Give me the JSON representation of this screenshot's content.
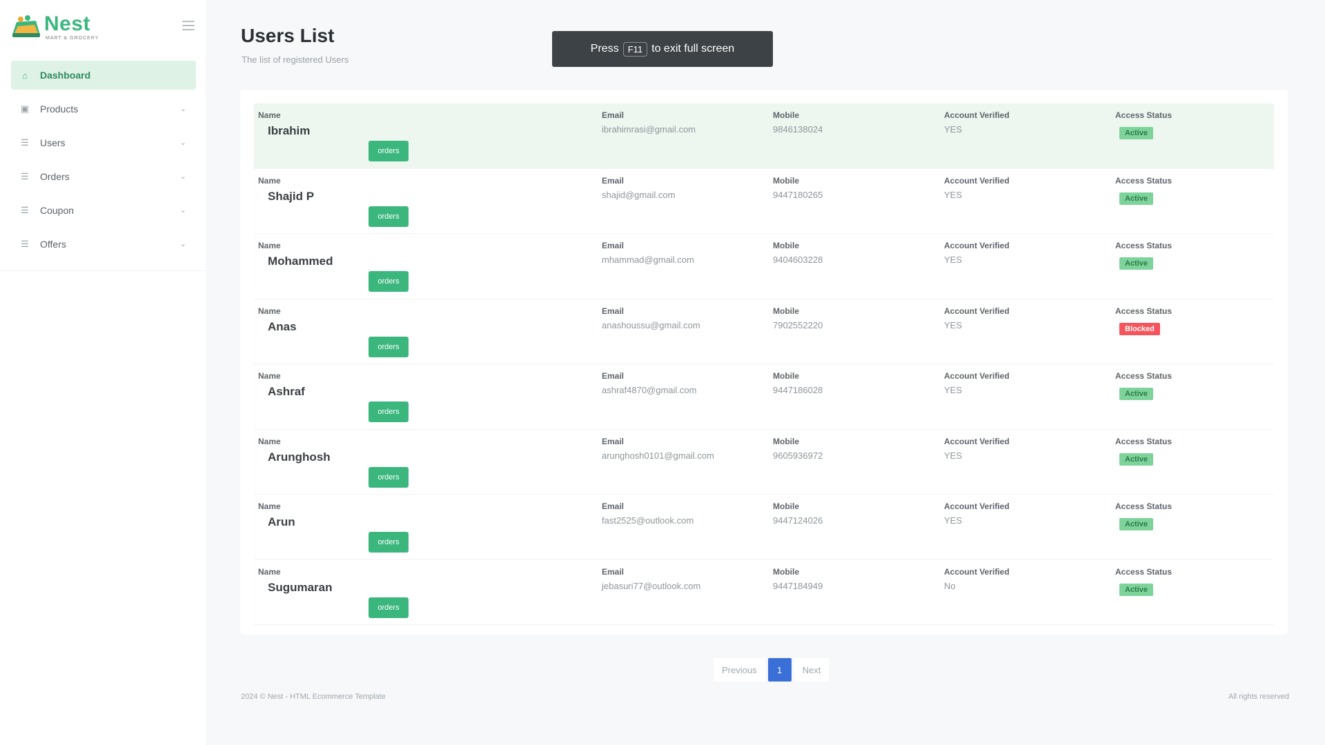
{
  "brand": {
    "name": "Nest",
    "tagline": "MART & GROCERY"
  },
  "sidebar": {
    "items": [
      {
        "label": "Dashboard",
        "icon": "home-icon",
        "active": true
      },
      {
        "label": "Products",
        "icon": "box-icon",
        "active": false
      },
      {
        "label": "Users",
        "icon": "users-icon",
        "active": false
      },
      {
        "label": "Orders",
        "icon": "cart-icon",
        "active": false
      },
      {
        "label": "Coupon",
        "icon": "ticket-icon",
        "active": false
      },
      {
        "label": "Offers",
        "icon": "tag-icon",
        "active": false
      }
    ]
  },
  "page": {
    "title": "Users List",
    "subtitle": "The list of registered Users"
  },
  "toast": {
    "prefix": "Press",
    "key": "F11",
    "suffix": "to exit full screen"
  },
  "table": {
    "labels": {
      "name": "Name",
      "email": "Email",
      "mobile": "Mobile",
      "verified": "Account Verified",
      "status": "Access Status"
    },
    "button_label": "orders",
    "rows": [
      {
        "name": "Ibrahim",
        "email": "ibrahimrasi@gmail.com",
        "mobile": "9846138024",
        "verified": "YES",
        "status": "Active",
        "status_kind": "active"
      },
      {
        "name": "Shajid P",
        "email": "shajid@gmail.com",
        "mobile": "9447180265",
        "verified": "YES",
        "status": "Active",
        "status_kind": "active"
      },
      {
        "name": "Mohammed",
        "email": "mhammad@gmail.com",
        "mobile": "9404603228",
        "verified": "YES",
        "status": "Active",
        "status_kind": "active"
      },
      {
        "name": "Anas",
        "email": "anashoussu@gmail.com",
        "mobile": "7902552220",
        "verified": "YES",
        "status": "Blocked",
        "status_kind": "blocked"
      },
      {
        "name": "Ashraf",
        "email": "ashraf4870@gmail.com",
        "mobile": "9447186028",
        "verified": "YES",
        "status": "Active",
        "status_kind": "active"
      },
      {
        "name": "Arunghosh",
        "email": "arunghosh0101@gmail.com",
        "mobile": "9605936972",
        "verified": "YES",
        "status": "Active",
        "status_kind": "active"
      },
      {
        "name": "Arun",
        "email": "fast2525@outlook.com",
        "mobile": "9447124026",
        "verified": "YES",
        "status": "Active",
        "status_kind": "active"
      },
      {
        "name": "Sugumaran",
        "email": "jebasuri77@outlook.com",
        "mobile": "9447184949",
        "verified": "No",
        "status": "Active",
        "status_kind": "active"
      }
    ]
  },
  "pagination": {
    "previous": "Previous",
    "current": "1",
    "next": "Next"
  },
  "footer": {
    "left": "2024 © Nest - HTML Ecommerce Template",
    "right": "All rights reserved"
  },
  "colors": {
    "brand_green": "#3bb77e",
    "active_nav_bg": "#def2e6",
    "blocked_red": "#f5545c",
    "page_blue": "#3b6fd8"
  }
}
